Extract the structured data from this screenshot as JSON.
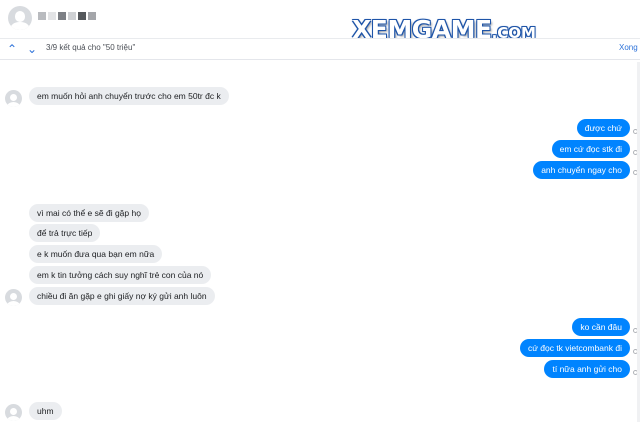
{
  "header": {
    "name_pixels": [
      "#b9bbbf",
      "#e3e4e6",
      "#7d8085",
      "#cfd1d4",
      "#55585c",
      "#a4a6aa"
    ]
  },
  "watermark": {
    "brand": "XEMGAME",
    "suffix": ".COM"
  },
  "search": {
    "up_icon": "chevron-up-icon",
    "down_icon": "chevron-down-icon",
    "result_text": "3/9 kết quả cho \"50 triệu\"",
    "done_label": "Xong"
  },
  "messages": [
    {
      "from": "them",
      "text": "em muốn hỏi anh chuyển trước cho em 50tr đc k"
    },
    {
      "from": "me",
      "text": "được chứ"
    },
    {
      "from": "me",
      "text": "em cứ đọc stk đi"
    },
    {
      "from": "me",
      "text": "anh chuyển ngay cho"
    },
    {
      "from": "them",
      "text": "vì mai có thể e sẽ đi gặp họ"
    },
    {
      "from": "them",
      "text": "để trả trực tiếp"
    },
    {
      "from": "them",
      "text": "e k muốn đưa qua bạn em nữa"
    },
    {
      "from": "them",
      "text": "em k tin tưởng cách suy nghĩ trẻ con của nó"
    },
    {
      "from": "them",
      "text": "chiều đi ăn gặp e ghi giấy nợ ký gửi anh luôn"
    },
    {
      "from": "me",
      "text": "ko cần đâu"
    },
    {
      "from": "me",
      "text": "cứ đọc tk vietcombank đi"
    },
    {
      "from": "me",
      "text": "tí nữa anh gửi cho"
    },
    {
      "from": "them",
      "text": "uhm"
    }
  ],
  "colors": {
    "outgoing": "#0084ff",
    "incoming": "#ebedf0",
    "accent": "#2d72d9"
  }
}
